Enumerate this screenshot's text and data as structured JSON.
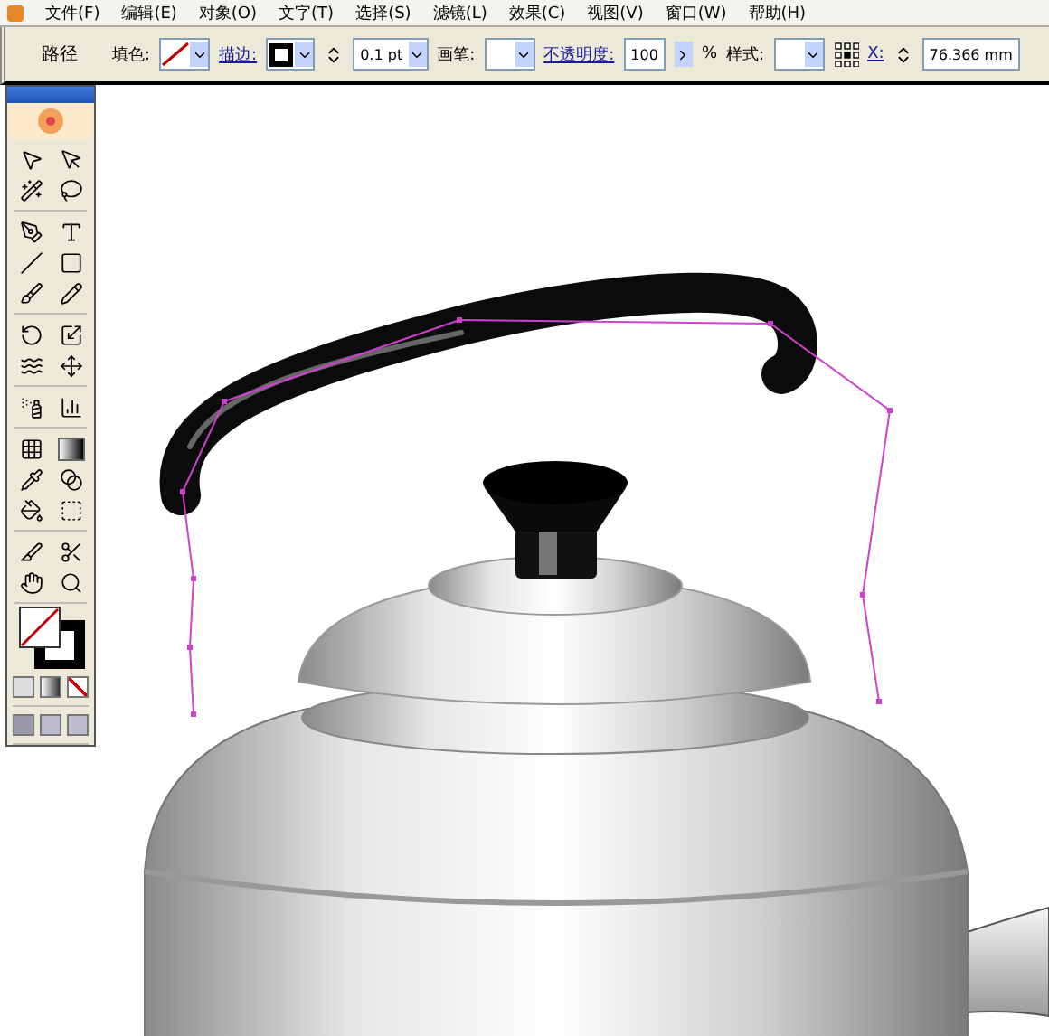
{
  "menu": [
    "文件(F)",
    "编辑(E)",
    "对象(O)",
    "文字(T)",
    "选择(S)",
    "滤镜(L)",
    "效果(C)",
    "视图(V)",
    "窗口(W)",
    "帮助(H)"
  ],
  "control_bar": {
    "selection": "路径",
    "items": [
      {
        "kind": "nofill",
        "label": "填色:",
        "link": false
      },
      {
        "kind": "stroke",
        "label": "描边:",
        "link": true
      },
      {
        "kind": "spinner",
        "value": "0.1 pt"
      },
      {
        "kind": "blank",
        "label": "画笔:",
        "link": false
      },
      {
        "kind": "percent",
        "label": "不透明度:",
        "link": true,
        "value": "100",
        "unit": "%"
      },
      {
        "kind": "blank",
        "label": "样式:",
        "link": false
      },
      {
        "kind": "refpoint"
      },
      {
        "kind": "coord",
        "label": "X:",
        "link": true,
        "value": "76.366 mm"
      }
    ]
  }
}
